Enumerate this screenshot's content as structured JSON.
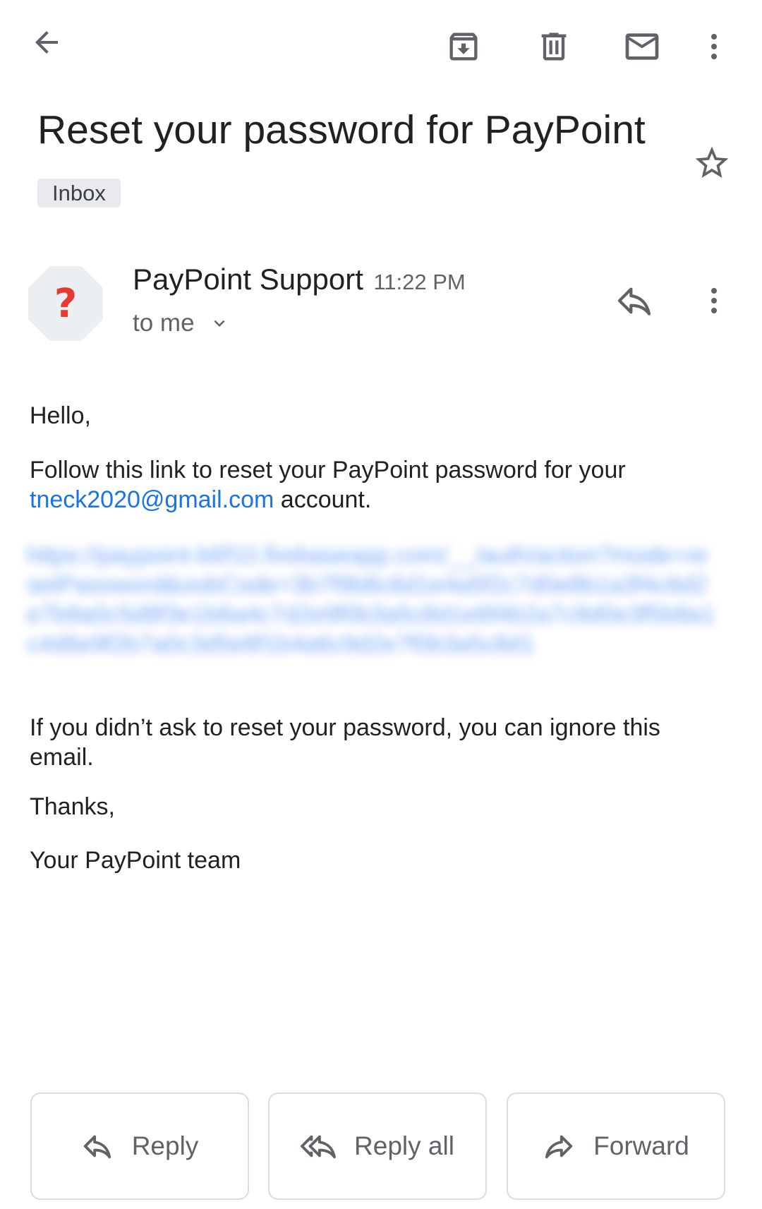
{
  "toolbar": {
    "back_icon": "arrow-back-icon",
    "archive_icon": "archive-icon",
    "delete_icon": "trash-icon",
    "mark_unread_icon": "mail-icon",
    "more_icon": "more-vertical-icon"
  },
  "email": {
    "subject": "Reset your password for PayPoint",
    "label": "Inbox",
    "star_icon": "star-outline-icon",
    "sender": {
      "avatar_glyph": "?",
      "name": "PayPoint Support",
      "time": "11:22 PM",
      "recipient": "to me"
    },
    "body": {
      "greeting": "Hello,",
      "instruction": "Follow this link to reset your PayPoint password for your",
      "email_address": "tneck2020@gmail.com",
      "instruction_end": "account.",
      "reset_link": "https://paypoint-b6f10.firebaseapp.com/__/auth/action?mode=resetPassword&oobCode=3b7f9b8c6d1e4a5f2c7d0e8b1a3f4c6d2e7b9a0c5d8f3e1b6a4c7d2e9f0b3a5c8d1e6f4b2a7c9d0e3f5b8a1c4d6e9f2b7a0c3d5e8f1b4a6c9d2e7f0b3a5c8d1",
      "ignore_notice": "If you didn’t ask to reset your password, you can ignore this email.",
      "thanks": "Thanks,",
      "signoff": "Your PayPoint team"
    }
  },
  "actions": {
    "reply": "Reply",
    "reply_all": "Reply all",
    "forward": "Forward"
  },
  "colors": {
    "link": "#1a73e8",
    "avatar_glyph": "#e53935",
    "label_chip": "#e8eaed"
  }
}
